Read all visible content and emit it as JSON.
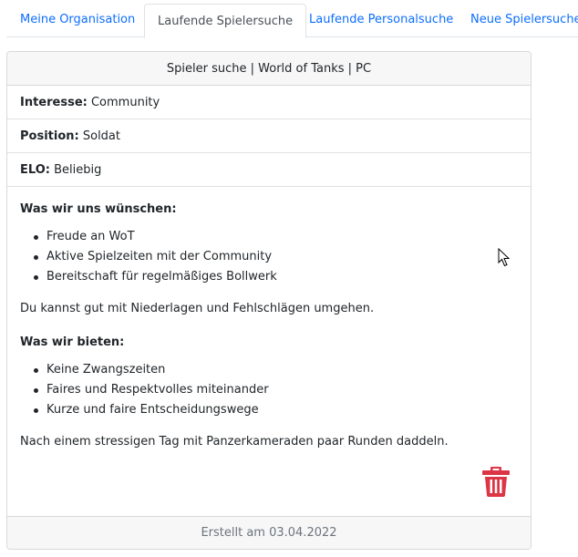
{
  "tabs": [
    {
      "label": "Meine Organisation",
      "active": false
    },
    {
      "label": "Laufende Spielersuche",
      "active": true
    },
    {
      "label": "Laufende Personalsuche",
      "active": false
    },
    {
      "label": "Neue Spielersuche",
      "active": false
    }
  ],
  "card": {
    "header": "Spieler suche | World of Tanks | PC",
    "fields": [
      {
        "label": "Interesse:",
        "value": "Community"
      },
      {
        "label": "Position:",
        "value": "Soldat"
      },
      {
        "label": "ELO:",
        "value": "Beliebig"
      }
    ],
    "wishes_heading": "Was wir uns wünschen:",
    "wishes": [
      "Freude an WoT",
      "Aktive Spielzeiten mit der Community",
      "Bereitschaft für regelmäßiges Bollwerk"
    ],
    "wishes_text": "Du kannst gut mit Niederlagen und Fehlschlägen umgehen.",
    "offer_heading": "Was wir bieten:",
    "offers": [
      "Keine Zwangszeiten",
      "Faires und Respektvolles miteinander",
      "Kurze und faire Entscheidungswege"
    ],
    "offer_text": "Nach einem stressigen Tag mit Panzerkameraden paar Runden daddeln.",
    "delete_icon": "trash-icon",
    "delete_color": "#dc3545",
    "footer": "Erstellt am 03.04.2022"
  },
  "colors": {
    "link": "#0d6efd",
    "muted": "#6c757d"
  }
}
